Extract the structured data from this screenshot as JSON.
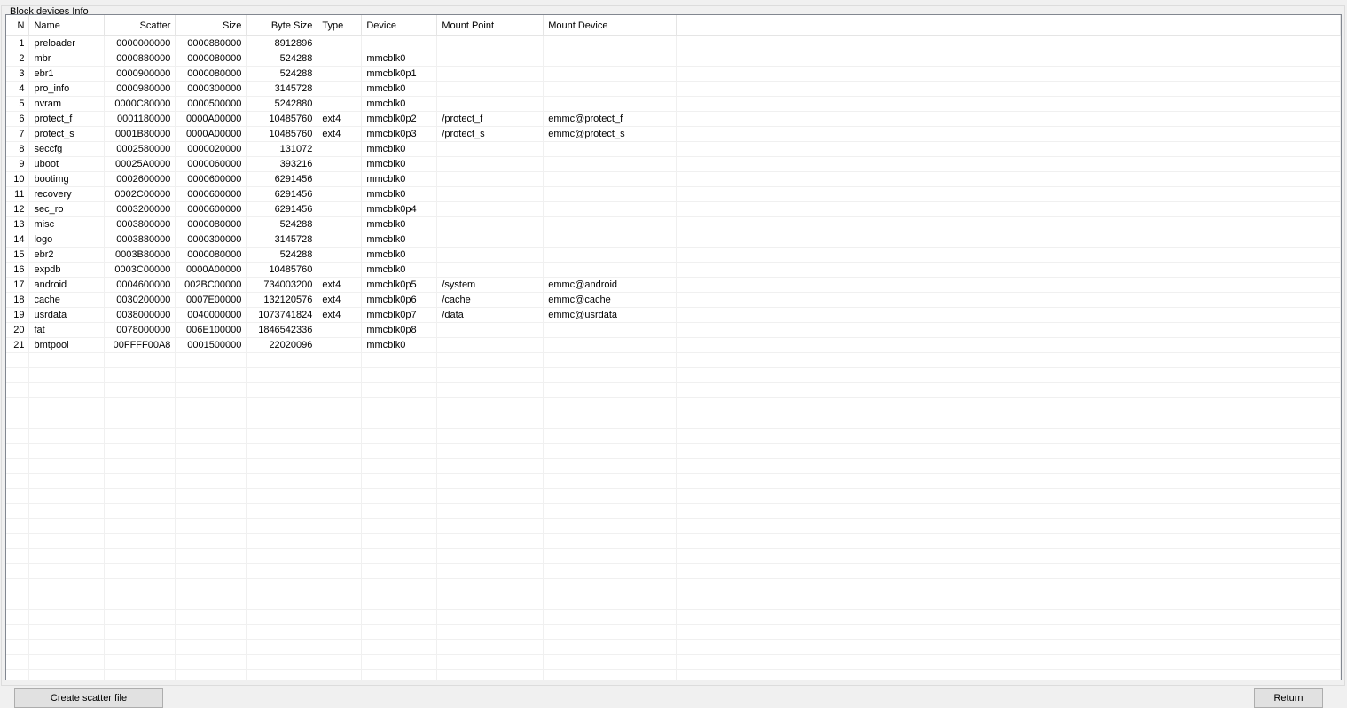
{
  "groupbox": {
    "title": "Block devices Info"
  },
  "columns": [
    "N",
    "Name",
    "Scatter",
    "Size",
    "Byte Size",
    "Type",
    "Device",
    "Mount Point",
    "Mount Device"
  ],
  "rows": [
    [
      "1",
      "preloader",
      "0000000000",
      "0000880000",
      "8912896",
      "",
      "",
      "",
      ""
    ],
    [
      "2",
      "mbr",
      "0000880000",
      "0000080000",
      "524288",
      "",
      "mmcblk0",
      "",
      ""
    ],
    [
      "3",
      "ebr1",
      "0000900000",
      "0000080000",
      "524288",
      "",
      "mmcblk0p1",
      "",
      ""
    ],
    [
      "4",
      "pro_info",
      "0000980000",
      "0000300000",
      "3145728",
      "",
      "mmcblk0",
      "",
      ""
    ],
    [
      "5",
      "nvram",
      "0000C80000",
      "0000500000",
      "5242880",
      "",
      "mmcblk0",
      "",
      ""
    ],
    [
      "6",
      "protect_f",
      "0001180000",
      "0000A00000",
      "10485760",
      "ext4",
      "mmcblk0p2",
      "/protect_f",
      "emmc@protect_f"
    ],
    [
      "7",
      "protect_s",
      "0001B80000",
      "0000A00000",
      "10485760",
      "ext4",
      "mmcblk0p3",
      "/protect_s",
      "emmc@protect_s"
    ],
    [
      "8",
      "seccfg",
      "0002580000",
      "0000020000",
      "131072",
      "",
      "mmcblk0",
      "",
      ""
    ],
    [
      "9",
      "uboot",
      "00025A0000",
      "0000060000",
      "393216",
      "",
      "mmcblk0",
      "",
      ""
    ],
    [
      "10",
      "bootimg",
      "0002600000",
      "0000600000",
      "6291456",
      "",
      "mmcblk0",
      "",
      ""
    ],
    [
      "11",
      "recovery",
      "0002C00000",
      "0000600000",
      "6291456",
      "",
      "mmcblk0",
      "",
      ""
    ],
    [
      "12",
      "sec_ro",
      "0003200000",
      "0000600000",
      "6291456",
      "",
      "mmcblk0p4",
      "",
      ""
    ],
    [
      "13",
      "misc",
      "0003800000",
      "0000080000",
      "524288",
      "",
      "mmcblk0",
      "",
      ""
    ],
    [
      "14",
      "logo",
      "0003880000",
      "0000300000",
      "3145728",
      "",
      "mmcblk0",
      "",
      ""
    ],
    [
      "15",
      "ebr2",
      "0003B80000",
      "0000080000",
      "524288",
      "",
      "mmcblk0",
      "",
      ""
    ],
    [
      "16",
      "expdb",
      "0003C00000",
      "0000A00000",
      "10485760",
      "",
      "mmcblk0",
      "",
      ""
    ],
    [
      "17",
      "android",
      "0004600000",
      "002BC00000",
      "734003200",
      "ext4",
      "mmcblk0p5",
      "/system",
      "emmc@android"
    ],
    [
      "18",
      "cache",
      "0030200000",
      "0007E00000",
      "132120576",
      "ext4",
      "mmcblk0p6",
      "/cache",
      "emmc@cache"
    ],
    [
      "19",
      "usrdata",
      "0038000000",
      "0040000000",
      "1073741824",
      "ext4",
      "mmcblk0p7",
      "/data",
      "emmc@usrdata"
    ],
    [
      "20",
      "fat",
      "0078000000",
      "006E100000",
      "1846542336",
      "",
      "mmcblk0p8",
      "",
      ""
    ],
    [
      "21",
      "bmtpool",
      "00FFFF00A8",
      "0001500000",
      "22020096",
      "",
      "mmcblk0",
      "",
      ""
    ]
  ],
  "buttons": {
    "left_label": "Create scatter file",
    "right_label": "Return"
  }
}
